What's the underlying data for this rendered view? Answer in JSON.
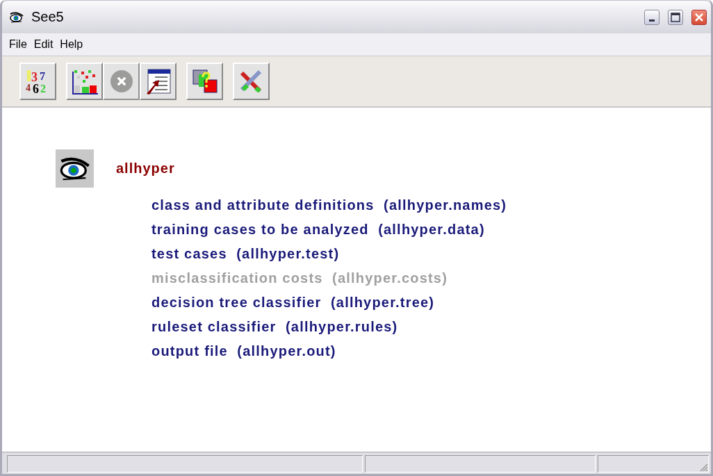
{
  "window": {
    "title": "See5"
  },
  "menu": [
    "File",
    "Edit",
    "Help"
  ],
  "toolbar": [
    {
      "kind": "numbers",
      "disabled": false,
      "glyphs": [
        "3",
        "7",
        "4",
        "6",
        "2"
      ]
    },
    {
      "kind": "chart",
      "disabled": false
    },
    {
      "kind": "cancel",
      "disabled": true
    },
    {
      "kind": "report",
      "disabled": false
    },
    {
      "kind": "cross",
      "disabled": false
    },
    {
      "kind": "exit",
      "disabled": false
    }
  ],
  "application": {
    "name": "allhyper"
  },
  "files": [
    {
      "label": "class and attribute definitions  (allhyper.names)",
      "disabled": false
    },
    {
      "label": "training cases to be analyzed  (allhyper.data)",
      "disabled": false
    },
    {
      "label": "test cases  (allhyper.test)",
      "disabled": false
    },
    {
      "label": "misclassification costs  (allhyper.costs)",
      "disabled": true
    },
    {
      "label": "decision tree classifier  (allhyper.tree)",
      "disabled": false
    },
    {
      "label": "ruleset classifier  (allhyper.rules)",
      "disabled": false
    },
    {
      "label": "output file  (allhyper.out)",
      "disabled": false
    }
  ]
}
